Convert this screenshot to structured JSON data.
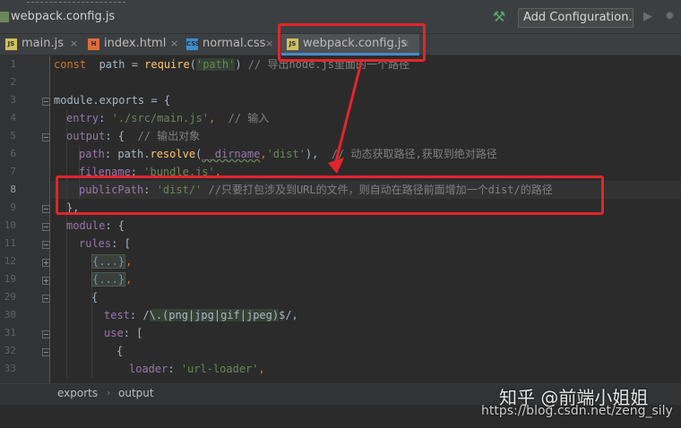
{
  "window": {
    "title": "webpack.config.js",
    "add_config_label": "Add Configuration..."
  },
  "tabs": [
    {
      "label": "main.js",
      "icon": "JS",
      "icon_color": "#d0c060"
    },
    {
      "label": "index.html",
      "icon": "H",
      "icon_color": "#e06c3a"
    },
    {
      "label": "normal.css",
      "icon": "CSS",
      "icon_color": "#3a8fd0"
    },
    {
      "label": "webpack.config.js",
      "icon": "JS",
      "icon_color": "#d0c060"
    }
  ],
  "tab_close": "×",
  "gutter": {
    "line_numbers": [
      "1",
      "2",
      "3",
      "4",
      "5",
      "6",
      "7",
      "8",
      "9",
      "10",
      "11",
      "12",
      "19",
      "29",
      "30",
      "31",
      "32",
      "33"
    ]
  },
  "code": {
    "l1": {
      "const": "const",
      "name": "  path = ",
      "req": "require",
      "open": "(",
      "arg": "'path'",
      "close": ")",
      "cmt": " // 导出node.js里面的一个路径"
    },
    "l3": {
      "text": "module.exports = {"
    },
    "l4": {
      "key": "entry",
      "colon": ": ",
      "val": "'./src/main.js'",
      "comma": ",",
      "cmt": "  // 输入"
    },
    "l5": {
      "key": "output",
      "rest": ": {",
      "cmt": "  // 输出对象"
    },
    "l6": {
      "key": "path",
      "colon": ": ",
      "obj": "path.",
      "fn": "resolve",
      "open": "(",
      "dirname": "__dirname",
      "c2": ",",
      "arg": "'dist'",
      "close": "),",
      "cmt": "  // 动态获取路径,获取到绝对路径"
    },
    "l7": {
      "key": "filename",
      "colon": ": ",
      "val": "'bundle.js'",
      "comma": ","
    },
    "l8": {
      "key": "publicPath",
      "colon": ": ",
      "val": "'dist/'",
      "cmt": " //只要打包涉及到URL的文件，则自动在路径前面增加一个dist/的路径"
    },
    "l9": {
      "text": "},"
    },
    "l10": {
      "key": "module",
      "rest": ": {"
    },
    "l11": {
      "key": "rules",
      "rest": ": ["
    },
    "l12": {
      "block": "{...}",
      "comma": ","
    },
    "l19": {
      "block": "{...}",
      "comma": ","
    },
    "l29": {
      "text": "{"
    },
    "l30": {
      "key": "test",
      "colon": ": /",
      "r1": "\\.(png|jpg|gif|jpeg)",
      "end": "$/,",
      "pre": ""
    },
    "l31": {
      "key": "use",
      "rest": ": ["
    },
    "l32": {
      "text": "{"
    },
    "l33": {
      "key": "loader",
      "colon": ": ",
      "val": "'url-loader'",
      "comma": ","
    }
  },
  "breadcrumb": {
    "items": [
      "exports",
      "output"
    ],
    "separator": "›"
  },
  "watermark": {
    "line1": "知乎 @前端小姐姐",
    "line2": "https://blog.csdn.net/zeng_sily"
  },
  "colors": {
    "annotation_red": "#e3252b",
    "active_tab_underline": "#4a88c7"
  }
}
